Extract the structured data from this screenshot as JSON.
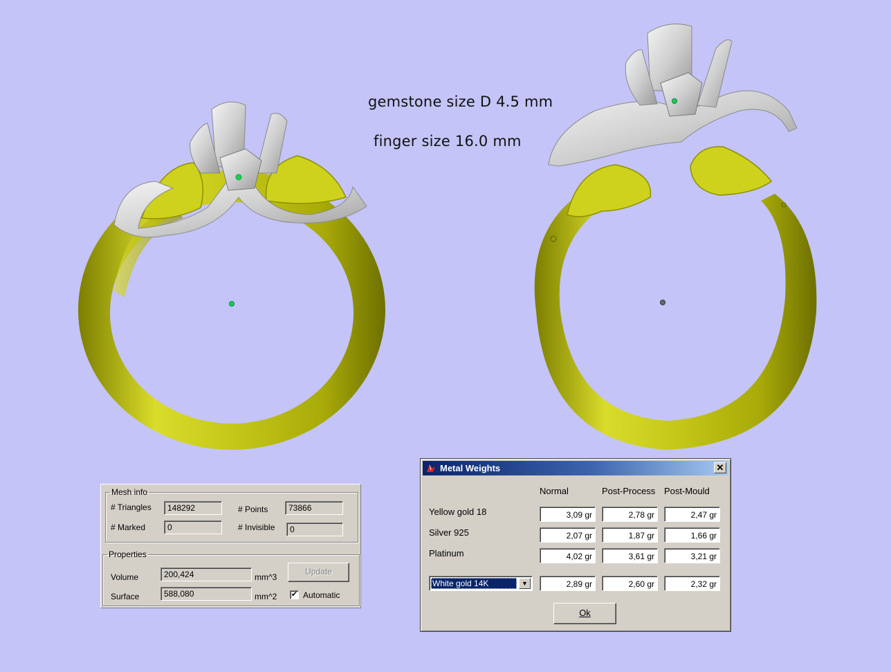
{
  "annotations": {
    "gemstone": "gemstone size D 4.5 mm",
    "finger": "finger size 16.0 mm"
  },
  "colors": {
    "background": "#c4c4f9",
    "ring_band": "#c8cc1a",
    "ring_head": "#d6d6d6",
    "pivot_green": "#22cc44"
  },
  "mesh_info": {
    "group": "Mesh info",
    "triangles_label": "# Triangles",
    "triangles": "148292",
    "points_label": "# Points",
    "points": "73866",
    "marked_label": "# Marked",
    "marked": "0",
    "invisible_label": "# Invisible",
    "invisible": "0"
  },
  "properties": {
    "group": "Properties",
    "volume_label": "Volume",
    "volume": "200,424",
    "volume_unit": "mm^3",
    "surface_label": "Surface",
    "surface": "588,080",
    "surface_unit": "mm^2",
    "update_label": "Update",
    "automatic_label": "Automatic",
    "automatic_checked": "✔"
  },
  "metal_weights": {
    "title": "Metal Weights",
    "close": "✕",
    "columns": [
      "Normal",
      "Post-Process",
      "Post-Mould"
    ],
    "rows": [
      {
        "metal": "Yellow gold 18",
        "values": [
          "3,09 gr",
          "2,78 gr",
          "2,47 gr"
        ]
      },
      {
        "metal": "Silver 925",
        "values": [
          "2,07 gr",
          "1,87 gr",
          "1,66 gr"
        ]
      },
      {
        "metal": "Platinum",
        "values": [
          "4,02 gr",
          "3,61 gr",
          "3,21 gr"
        ]
      }
    ],
    "selected_metal": "White gold 14K",
    "selected_values": [
      "2,89 gr",
      "2,60 gr",
      "2,32 gr"
    ],
    "ok_label": "Ok"
  }
}
